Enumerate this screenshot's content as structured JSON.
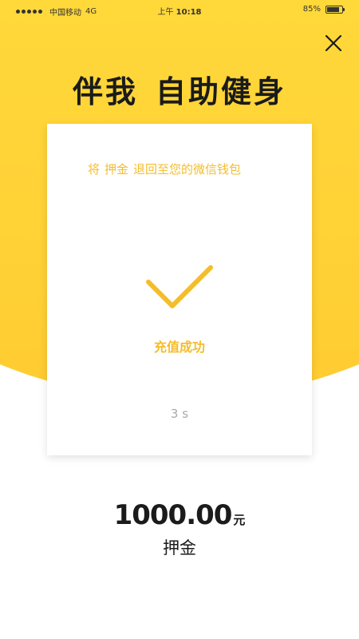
{
  "status_bar": {
    "carrier": "中国移动",
    "network": "4G",
    "time_prefix": "上午",
    "time": "10:18",
    "battery": "85%",
    "battery_level": 0.85
  },
  "header": {
    "title_part1": "伴我",
    "title_part2": "自助健身",
    "close_icon": "close-icon"
  },
  "card": {
    "tip_part1": "将",
    "tip_part2": "押金",
    "tip_part3": "退回至您的微信钱包",
    "check_icon": "checkmark-icon",
    "success_text": "充值成功",
    "countdown": "3 s"
  },
  "deposit": {
    "amount": "1000.00",
    "unit": "元",
    "label": "押金"
  },
  "colors": {
    "brand_yellow": "#FFD035",
    "accent": "#F4BD2B",
    "text_dark": "#1b1b1b",
    "text_muted": "#a9a9a9"
  }
}
